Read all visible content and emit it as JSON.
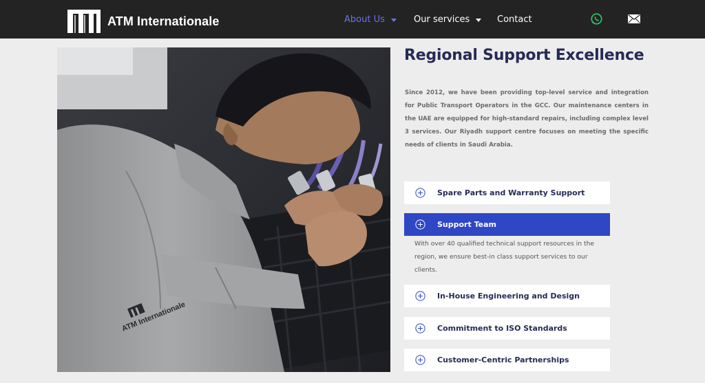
{
  "brand": {
    "name": "ATM Internationale"
  },
  "nav": {
    "about": "About Us",
    "services": "Our services",
    "contact": "Contact"
  },
  "icons": {
    "whatsapp": "whatsapp-icon",
    "mail": "mail-icon",
    "accordion": "plus-circle-icon"
  },
  "colors": {
    "header_bg": "#232323",
    "nav_active": "#6b72e6",
    "heading": "#262a55",
    "accordion_active": "#2f46c5",
    "whatsapp": "#2fc16a"
  },
  "photo": {
    "sleeve_logo_text": "ATM Internationale"
  },
  "section": {
    "title": "Regional Support Excellence",
    "intro": "Since 2012, we have been providing top-level service and integration for Public Transport Operators in the GCC. Our maintenance centers in the UAE are equipped for high-standard repairs, including complex level 3 services. Our Riyadh support centre focuses on meeting the specific needs of clients in Saudi Arabia."
  },
  "accordion": [
    {
      "label": "Spare Parts and Warranty Support",
      "expanded": false
    },
    {
      "label": "Support Team",
      "expanded": true,
      "body": "With over 40 qualified technical support resources in the region, we ensure best-in class support services to our clients."
    },
    {
      "label": "In-House Engineering and Design",
      "expanded": false
    },
    {
      "label": "Commitment to ISO Standards",
      "expanded": false
    },
    {
      "label": "Customer-Centric Partnerships",
      "expanded": false
    }
  ]
}
